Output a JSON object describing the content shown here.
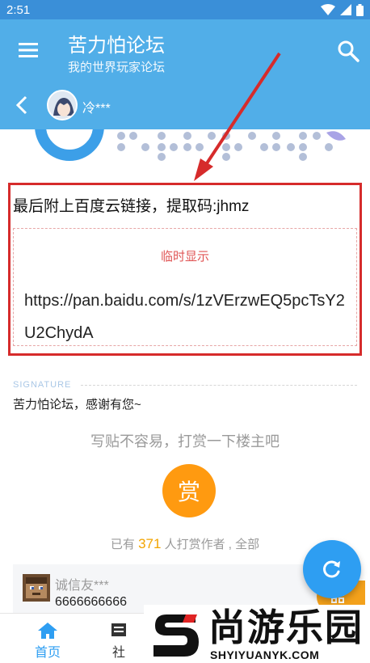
{
  "status_bar": {
    "time": "2:51"
  },
  "app_bar": {
    "title": "苦力怕论坛",
    "subtitle": "我的世界玩家论坛"
  },
  "thread_bar": {
    "author_name": "冷***"
  },
  "post": {
    "text": "最后附上百度云链接，提取码:jhmz",
    "hidden_label": "临时显示",
    "link": "https://pan.baidu.com/s/1zVErzwEQ5pcTsY2U2ChydA"
  },
  "signature": {
    "label": "SIGNATURE",
    "text": "苦力怕论坛，感谢有您~"
  },
  "reward": {
    "title": "写贴不容易，打赏一下楼主吧",
    "button_label": "赏",
    "count_prefix": "已有",
    "count": "371",
    "count_suffix": "人打赏作者 , 全部"
  },
  "comment": {
    "name": "诚信友***",
    "text": "6666666666"
  },
  "tabs": [
    {
      "label": "首页"
    },
    {
      "label": "社"
    }
  ],
  "watermark": {
    "text": "尚游乐园",
    "sub": "SHYIYUANYK.COM"
  },
  "colors": {
    "primary": "#51aee8",
    "accent": "#2e9ef2",
    "reward": "#ff9a10",
    "highlight": "#d62b2b"
  }
}
